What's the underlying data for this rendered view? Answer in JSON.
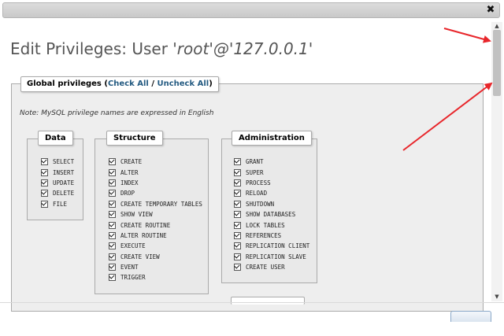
{
  "window": {
    "close_glyph": "✖"
  },
  "dialog": {
    "title_prefix": "Edit Privileges: User ",
    "title_user": "'root'@'127.0.0.1'"
  },
  "global_privileges": {
    "legend_label": "Global privileges (",
    "check_all": "Check All",
    "separator": " / ",
    "uncheck_all": "Uncheck All",
    "legend_close": ")",
    "note": "Note: MySQL privilege names are expressed in English"
  },
  "groups": {
    "data": {
      "title": "Data",
      "items": [
        "SELECT",
        "INSERT",
        "UPDATE",
        "DELETE",
        "FILE"
      ]
    },
    "structure": {
      "title": "Structure",
      "items": [
        "CREATE",
        "ALTER",
        "INDEX",
        "DROP",
        "CREATE TEMPORARY TABLES",
        "SHOW VIEW",
        "CREATE ROUTINE",
        "ALTER ROUTINE",
        "EXECUTE",
        "CREATE VIEW",
        "EVENT",
        "TRIGGER"
      ]
    },
    "administration": {
      "title": "Administration",
      "items": [
        "GRANT",
        "SUPER",
        "PROCESS",
        "RELOAD",
        "SHUTDOWN",
        "SHOW DATABASES",
        "LOCK TABLES",
        "REFERENCES",
        "REPLICATION CLIENT",
        "REPLICATION SLAVE",
        "CREATE USER"
      ]
    }
  },
  "scrollbar": {
    "up_glyph": "▲",
    "down_glyph": "▼"
  },
  "colors": {
    "link": "#235a81",
    "annotation_arrow": "#e8262b"
  }
}
